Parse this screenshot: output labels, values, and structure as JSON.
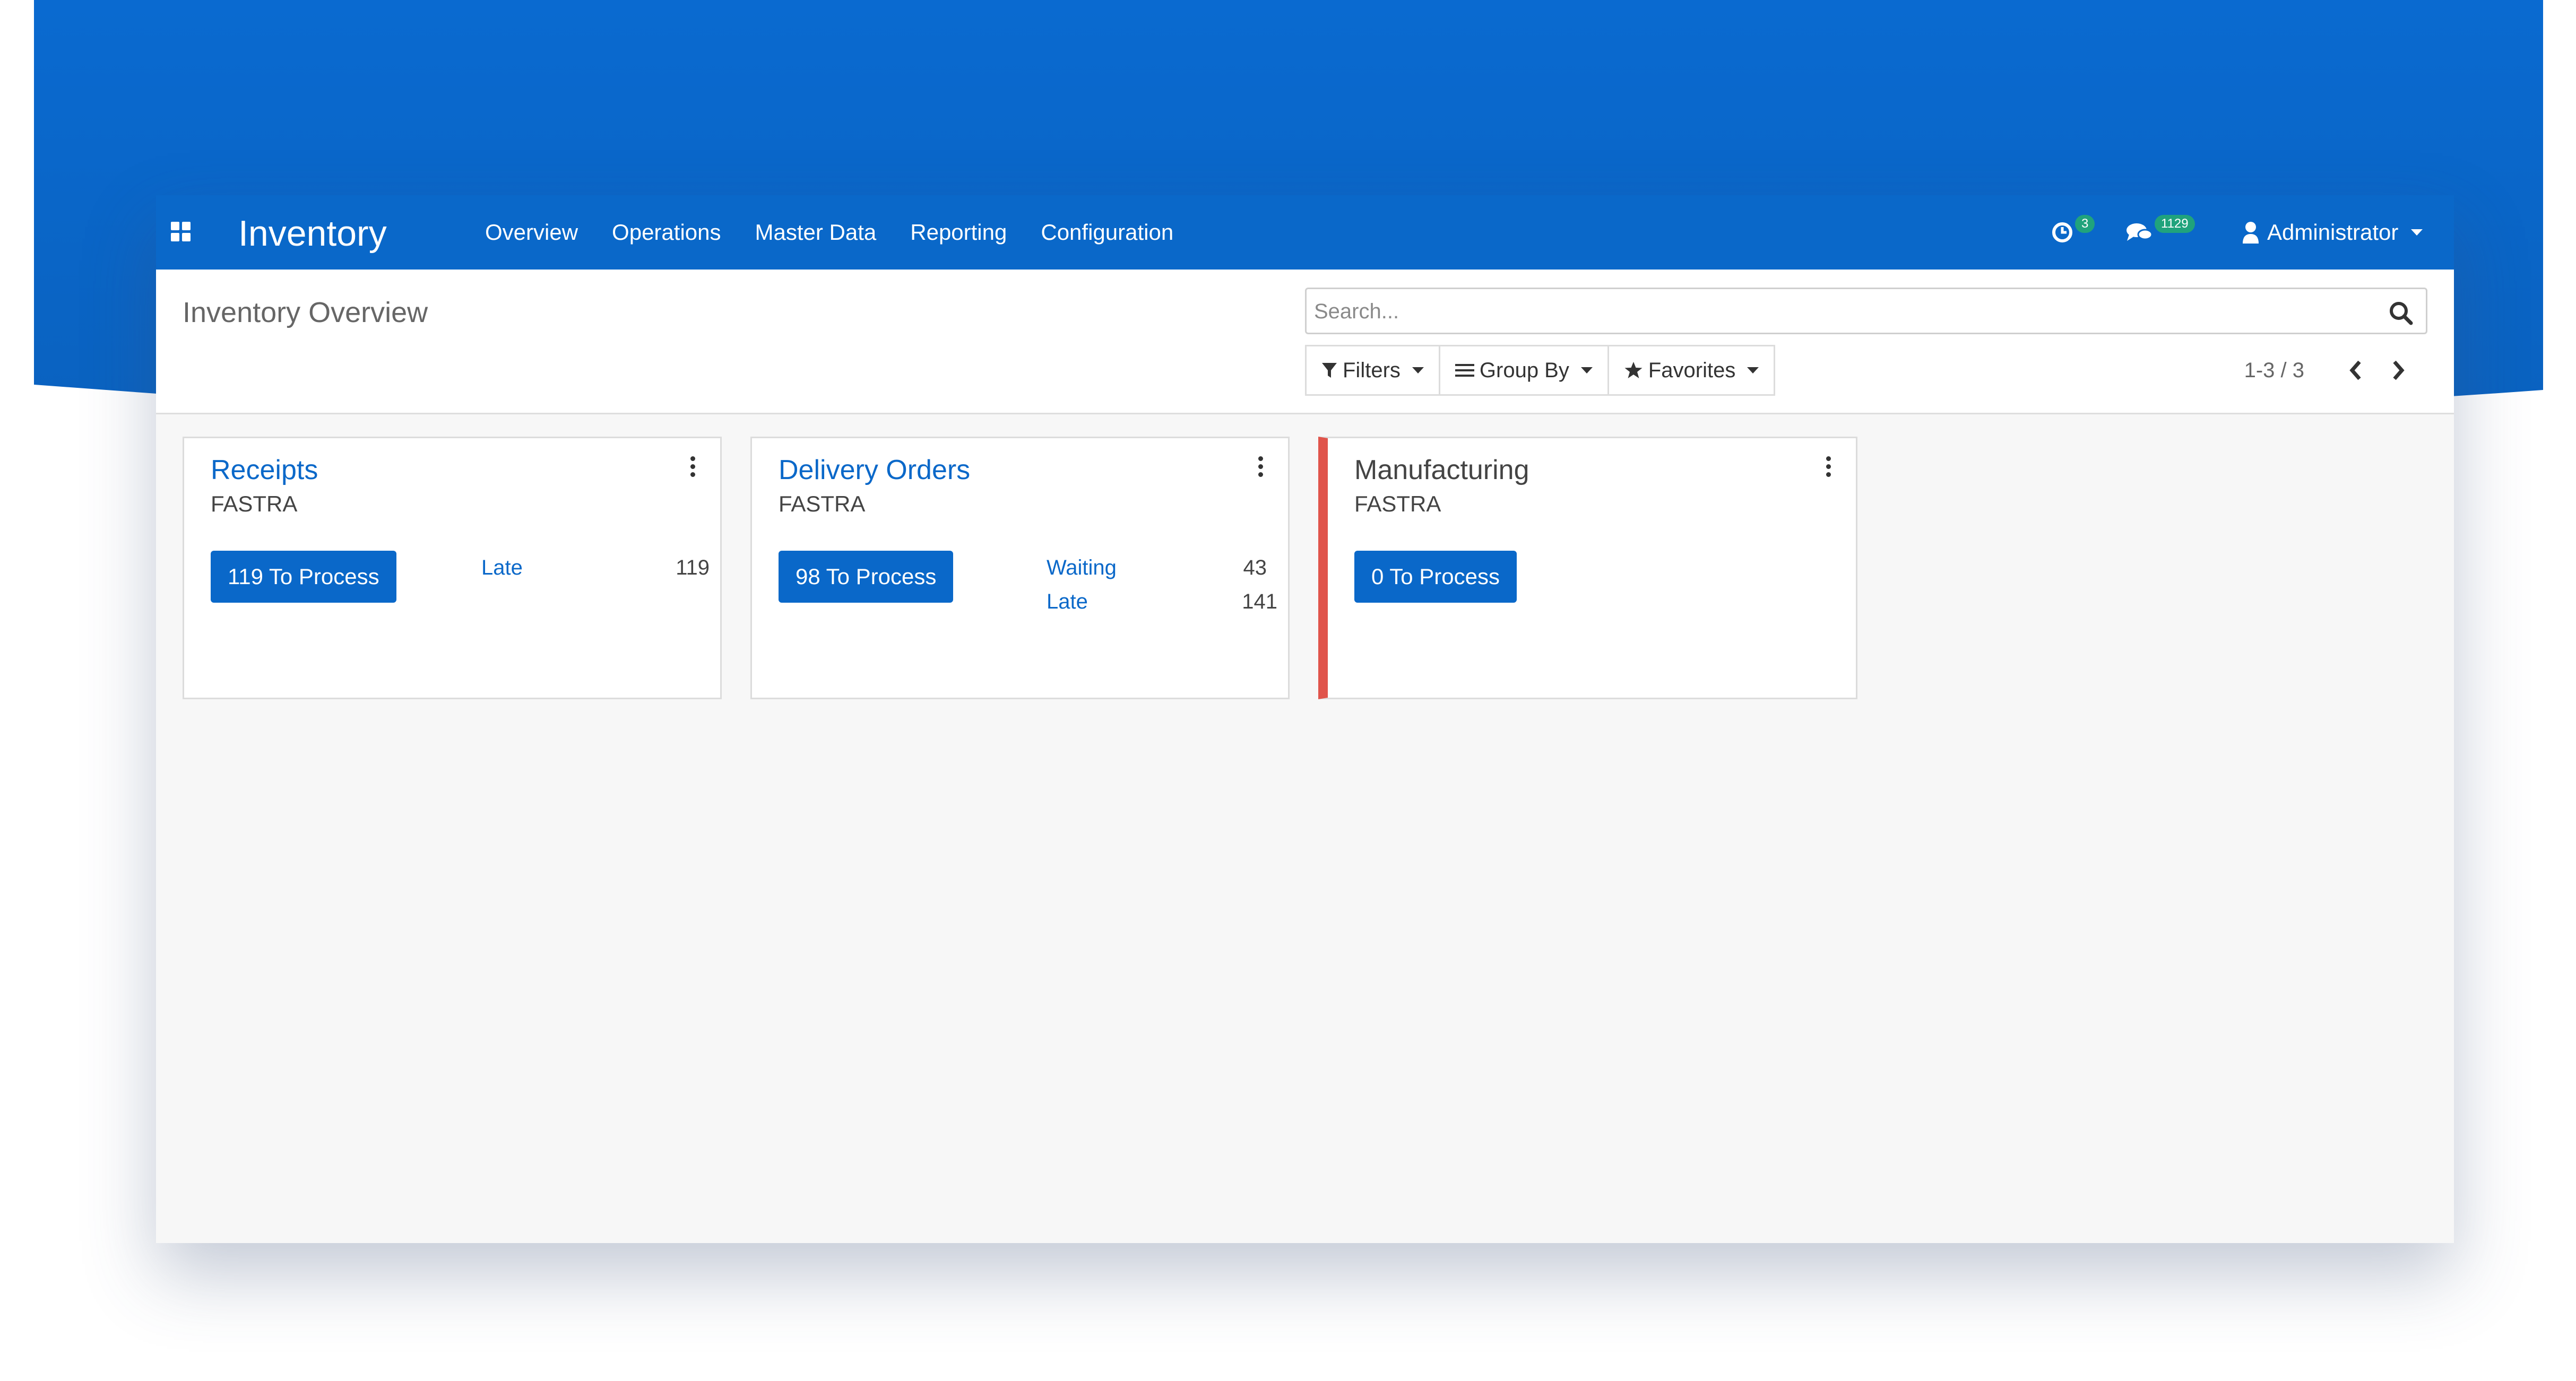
{
  "navbar": {
    "app_title": "Inventory",
    "menu": [
      "Overview",
      "Operations",
      "Master Data",
      "Reporting",
      "Configuration"
    ],
    "activity_badge": "3",
    "messages_badge": "1129",
    "user_name": "Administrator"
  },
  "control_panel": {
    "breadcrumb": "Inventory Overview",
    "search_placeholder": "Search...",
    "filters_label": "Filters",
    "groupby_label": "Group By",
    "favorites_label": "Favorites",
    "pager_value": "1-3 / 3"
  },
  "cards": [
    {
      "title": "Receipts",
      "subtitle": "FASTRA",
      "button": "119 To Process",
      "stats": [
        {
          "label": "Late",
          "count": "119"
        }
      ]
    },
    {
      "title": "Delivery Orders",
      "subtitle": "FASTRA",
      "button": "98 To Process",
      "stats": [
        {
          "label": "Waiting",
          "count": "43"
        },
        {
          "label": "Late",
          "count": "141"
        }
      ]
    },
    {
      "title": "Manufacturing",
      "subtitle": "FASTRA",
      "button": "0 To Process",
      "stats": []
    }
  ],
  "colors": {
    "primary": "#0a68c9",
    "badge_green": "#20a37c",
    "manufacturing_accent": "#e0544b",
    "banner_blue": "#0a68c9"
  },
  "icons": [
    "apps-grid-icon",
    "activity-clock-icon",
    "messages-icon",
    "user-icon",
    "search-icon",
    "filter-icon",
    "group-by-icon",
    "star-icon",
    "chevron-left-icon",
    "chevron-right-icon",
    "kebab-menu-icon"
  ]
}
